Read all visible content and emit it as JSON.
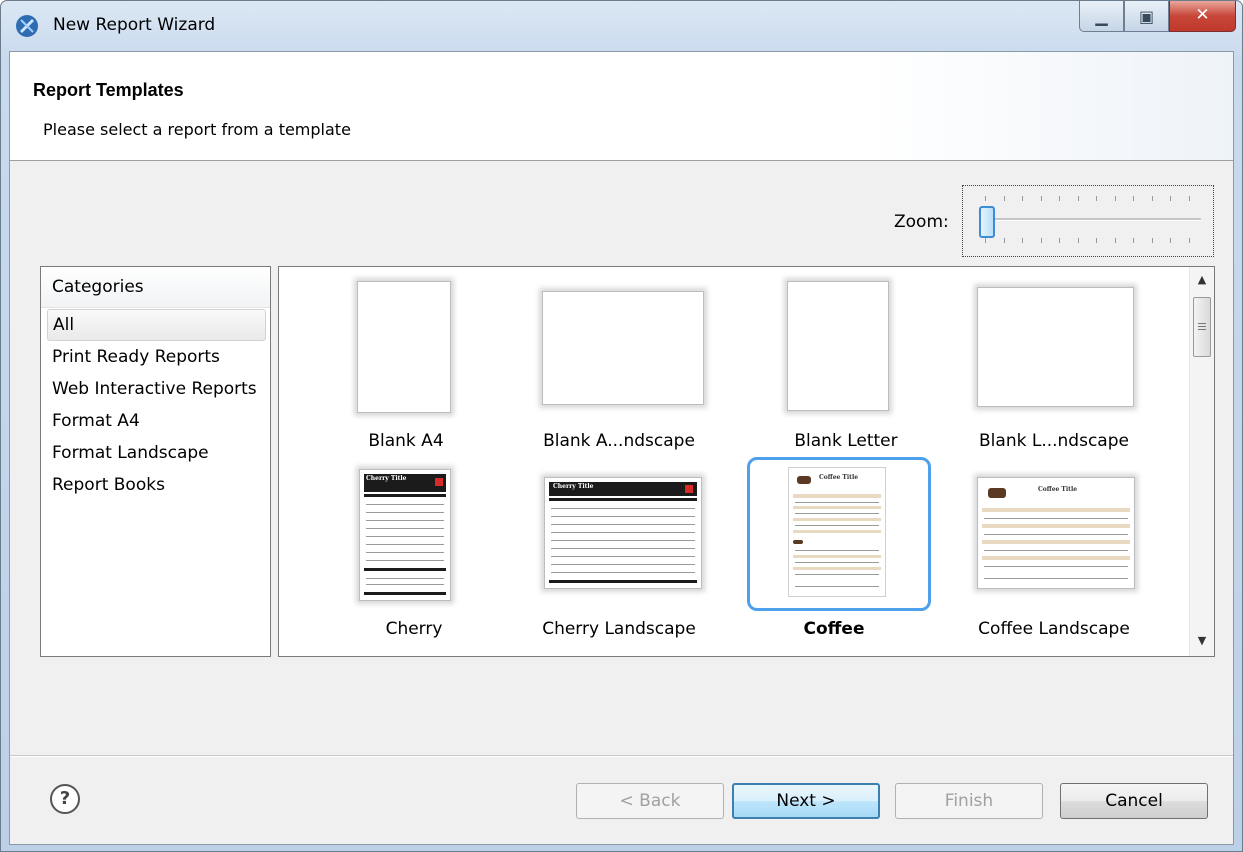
{
  "window": {
    "title": "New Report Wizard",
    "icon": "report-wizard-icon",
    "controls": [
      "minimize-icon",
      "maximize-icon",
      "close-icon"
    ]
  },
  "header": {
    "title": "Report Templates",
    "description": "Please select a report from a template"
  },
  "zoom": {
    "label": "Zoom:",
    "level": 0.0
  },
  "categories": {
    "header": "Categories",
    "items": [
      {
        "label": "All",
        "selected": true
      },
      {
        "label": "Print Ready Reports"
      },
      {
        "label": "Web Interactive Reports"
      },
      {
        "label": "Format A4"
      },
      {
        "label": "Format Landscape"
      },
      {
        "label": "Report Books"
      }
    ]
  },
  "templates": [
    {
      "label": "Blank A4",
      "kind": "blank-portrait"
    },
    {
      "label": "Blank A...ndscape",
      "kind": "blank-landscape"
    },
    {
      "label": "Blank Letter",
      "kind": "blank-portrait"
    },
    {
      "label": "Blank L...ndscape",
      "kind": "blank-landscape"
    },
    {
      "label": "Cherry",
      "kind": "cherry-portrait",
      "preview_title": "Cherry Title"
    },
    {
      "label": "Cherry Landscape",
      "kind": "cherry-landscape",
      "preview_title": "Cherry Title"
    },
    {
      "label": "Coffee",
      "kind": "coffee-portrait",
      "preview_title": "Coffee Title",
      "selected": true
    },
    {
      "label": "Coffee Landscape",
      "kind": "coffee-landscape",
      "preview_title": "Coffee Title"
    }
  ],
  "buttons": {
    "help": "help-icon",
    "back": "< Back",
    "next": "Next >",
    "finish": "Finish",
    "cancel": "Cancel"
  },
  "colors": {
    "selection": "#4ea0ec",
    "cherry_red": "#d72b2b",
    "coffee_tan": "#e9d9c0"
  }
}
